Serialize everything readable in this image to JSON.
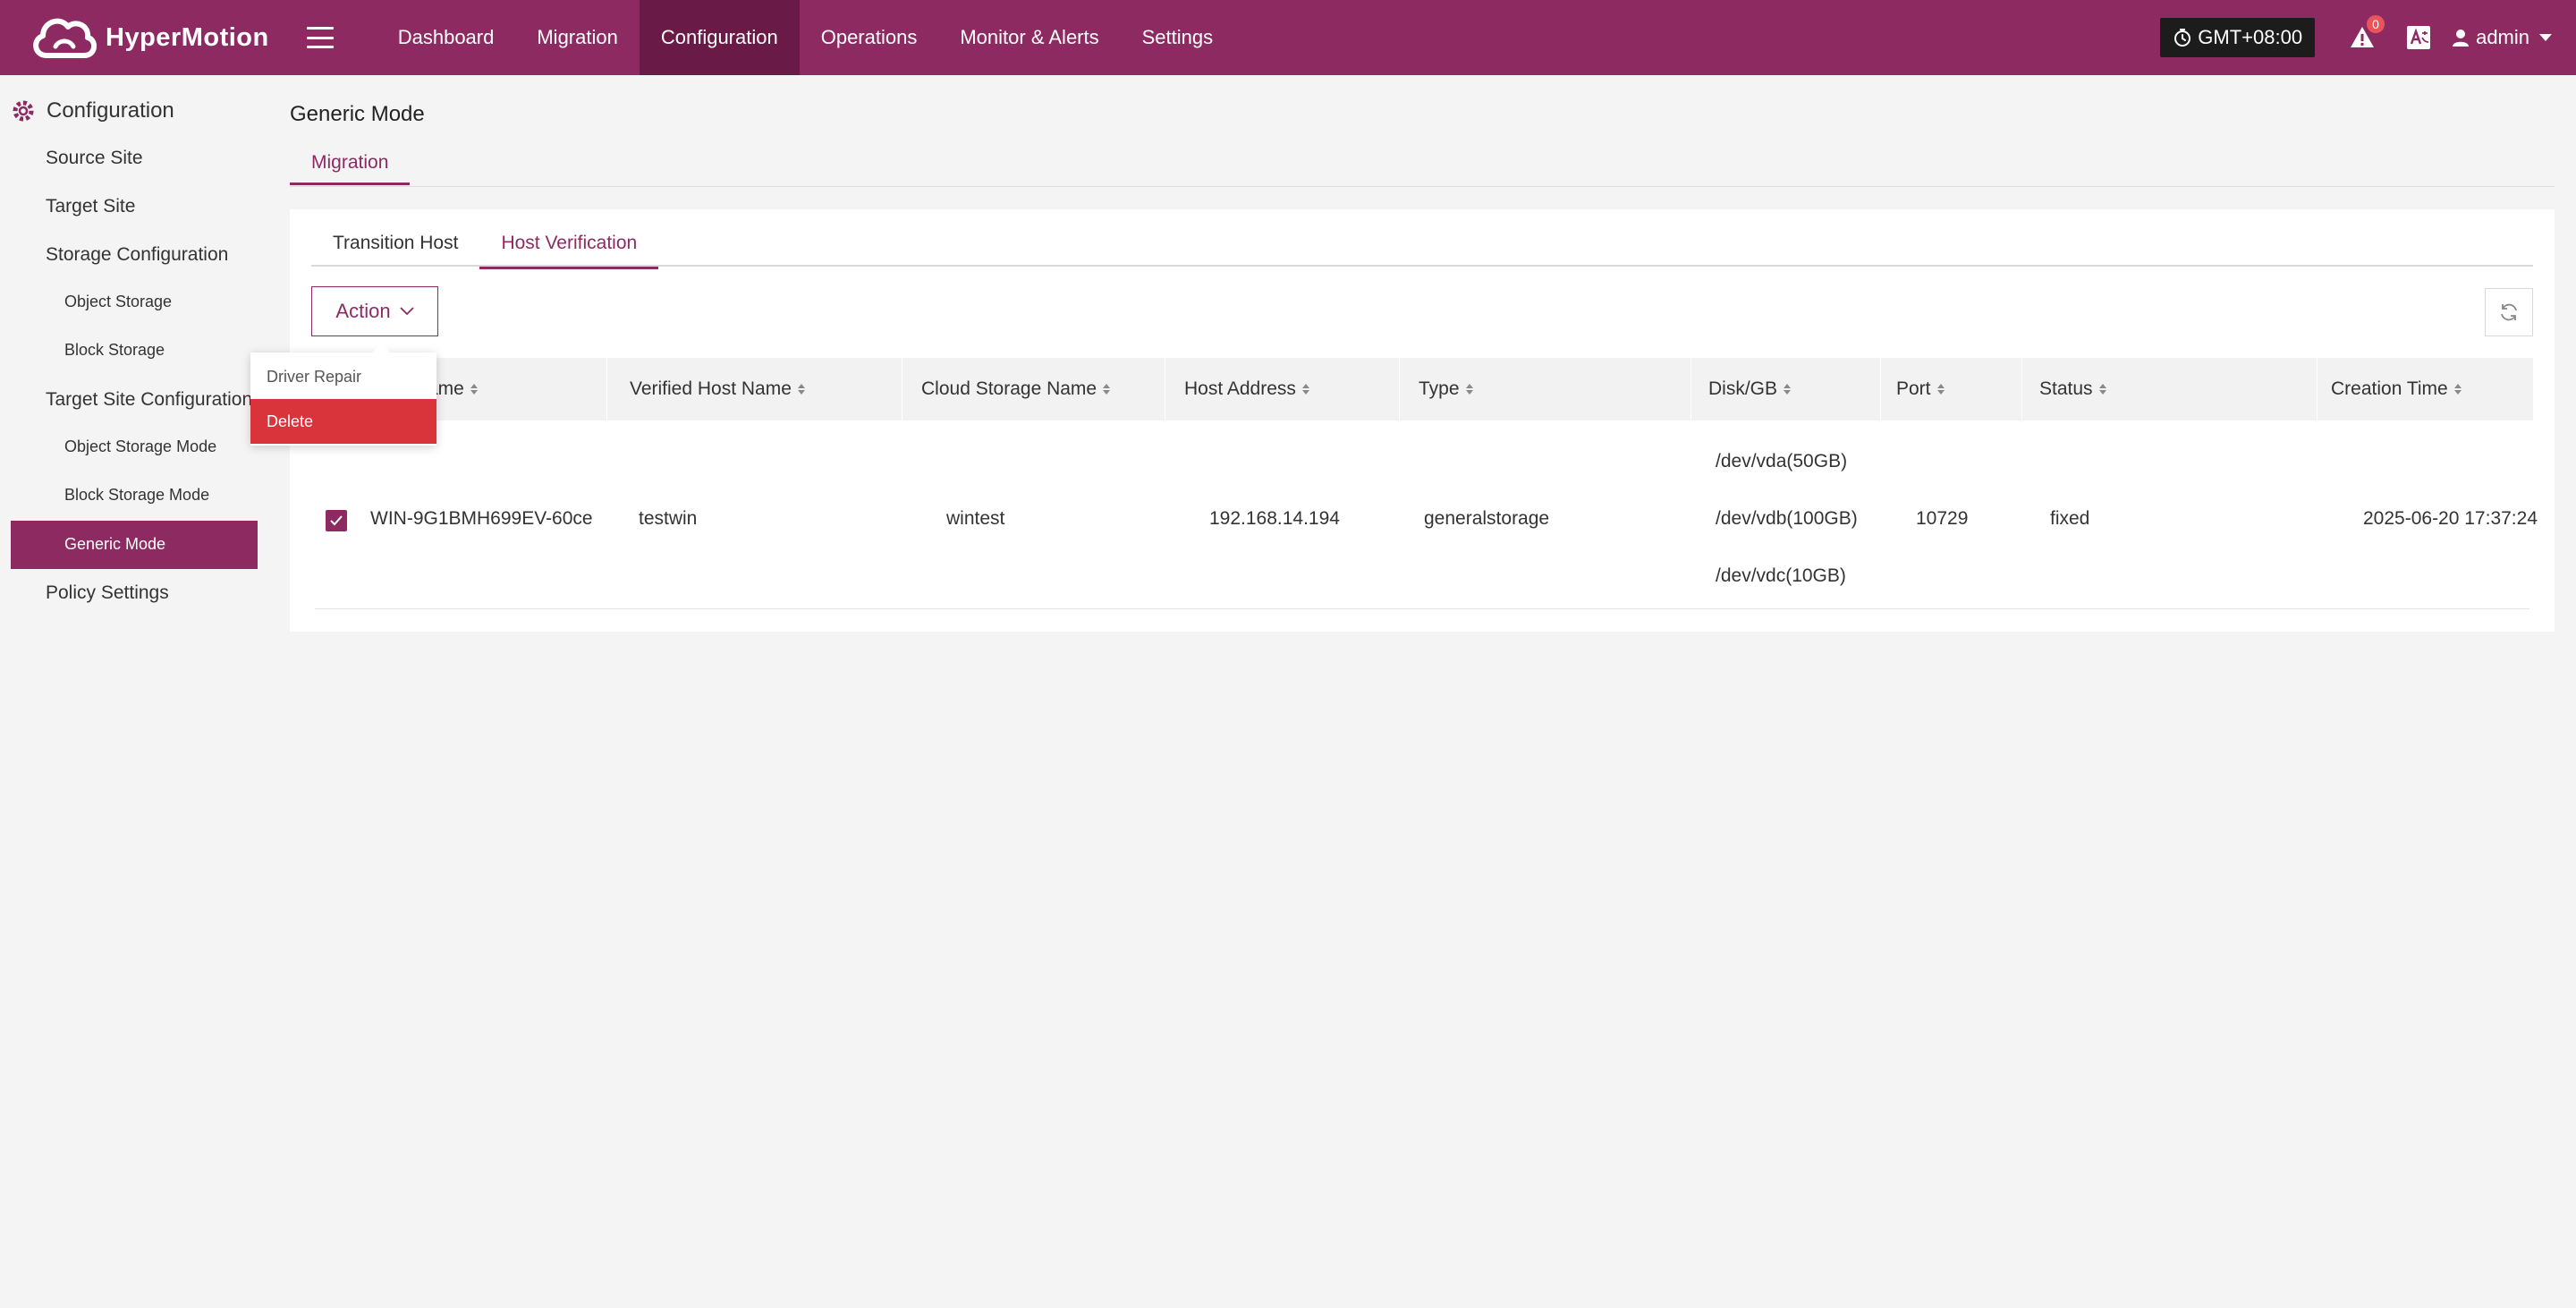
{
  "app": {
    "name": "HyperMotion",
    "brand_color": "#8e2a62",
    "nav_active_color": "#6a1a47"
  },
  "header": {
    "nav": [
      {
        "label": "Dashboard",
        "active": false
      },
      {
        "label": "Migration",
        "active": false
      },
      {
        "label": "Configuration",
        "active": true
      },
      {
        "label": "Operations",
        "active": false
      },
      {
        "label": "Monitor & Alerts",
        "active": false
      },
      {
        "label": "Settings",
        "active": false
      }
    ],
    "timezone": "GMT+08:00",
    "alert_count": "0",
    "user": "admin"
  },
  "sidebar": {
    "title": "Configuration",
    "items": {
      "source_site": "Source Site",
      "target_site": "Target Site",
      "storage_configuration": "Storage Configuration",
      "object_storage": "Object Storage",
      "block_storage": "Block Storage",
      "target_site_configuration": "Target Site Configuration",
      "object_storage_mode": "Object Storage Mode",
      "block_storage_mode": "Block Storage Mode",
      "generic_mode": "Generic Mode",
      "policy_settings": "Policy Settings"
    },
    "active": "generic_mode"
  },
  "main": {
    "page_title": "Generic Mode",
    "top_tab": "Migration",
    "sub_tabs": [
      {
        "label": "Transition Host",
        "active": false
      },
      {
        "label": "Host Verification",
        "active": true
      }
    ],
    "action_label": "Action",
    "dropdown": {
      "items": [
        {
          "label": "Driver Repair",
          "danger": false
        },
        {
          "label": "Delete",
          "danger": true
        }
      ]
    },
    "table": {
      "columns": {
        "host_name": "ame",
        "verified_host_name": "Verified Host Name",
        "cloud_storage_name": "Cloud Storage Name",
        "host_address": "Host Address",
        "type": "Type",
        "disk": "Disk/GB",
        "port": "Port",
        "status": "Status",
        "creation_time": "Creation Time"
      },
      "rows": [
        {
          "selected": true,
          "host_name": "WIN-9G1BMH699EV-60ce",
          "verified_host_name": "testwin",
          "cloud_storage_name": "wintest",
          "host_address": "192.168.14.194",
          "type": "generalstorage",
          "disks": [
            "/dev/vda(50GB)",
            "/dev/vdb(100GB)",
            "/dev/vdc(10GB)"
          ],
          "port": "10729",
          "status": "fixed",
          "creation_time": "2025-06-20 17:37:24"
        }
      ]
    }
  }
}
